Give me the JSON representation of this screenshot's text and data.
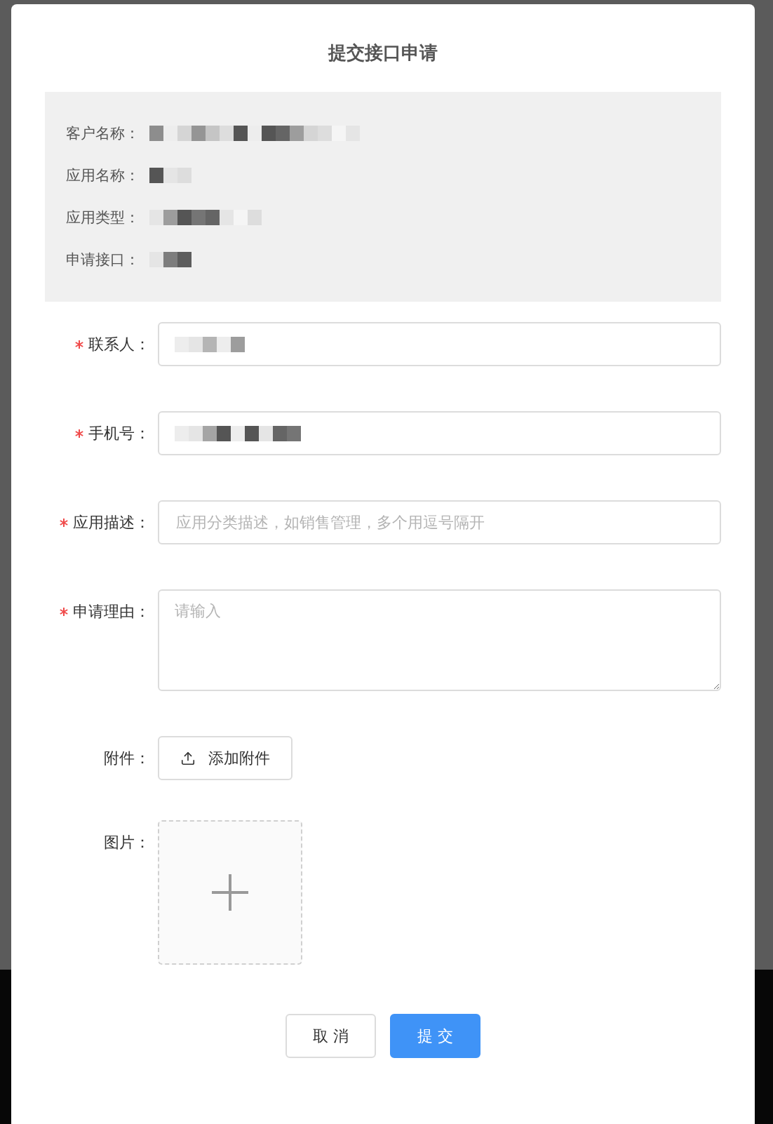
{
  "dialog": {
    "title": "提交接口申请"
  },
  "info": [
    {
      "label": "客户名称：",
      "redacted": true
    },
    {
      "label": "应用名称：",
      "redacted": true
    },
    {
      "label": "应用类型：",
      "redacted": true
    },
    {
      "label": "申请接口：",
      "redacted": true
    }
  ],
  "form": [
    {
      "kind": "input",
      "label": "联系人：",
      "required": true,
      "redacted": true
    },
    {
      "kind": "input",
      "label": "手机号：",
      "required": true,
      "redacted": true
    },
    {
      "kind": "input",
      "label": "应用描述：",
      "required": true,
      "placeholder": "应用分类描述，如销售管理，多个用逗号隔开"
    },
    {
      "kind": "textarea",
      "label": "申请理由：",
      "required": true,
      "placeholder": "请输入"
    },
    {
      "kind": "upload",
      "label": "附件：",
      "required": false,
      "button": "添加附件"
    },
    {
      "kind": "image",
      "label": "图片：",
      "required": false
    }
  ],
  "buttons": [
    {
      "label": "取 消",
      "kind": "default"
    },
    {
      "label": "提 交",
      "kind": "primary"
    }
  ]
}
